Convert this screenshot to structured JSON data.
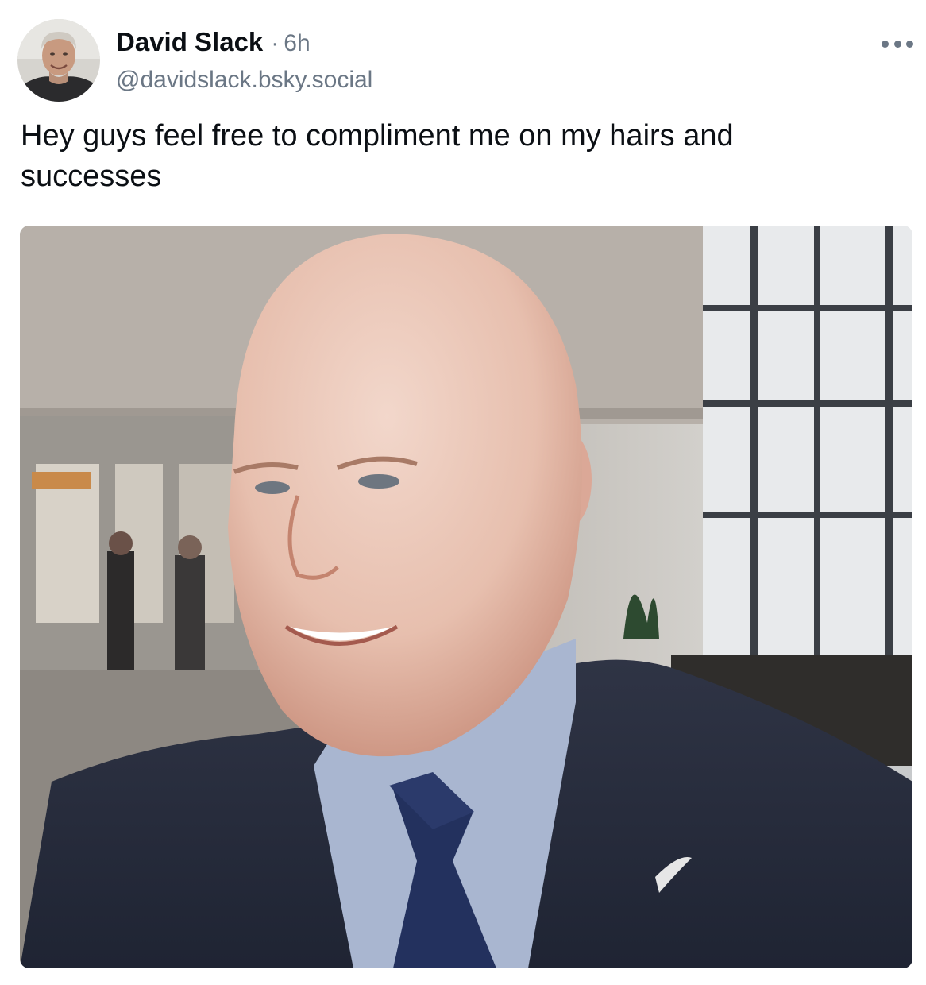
{
  "post": {
    "author": {
      "display_name": "David Slack",
      "handle": "@davidslack.bsky.social"
    },
    "separator": "·",
    "time": "6h",
    "text": "Hey guys feel free to compliment me on my hairs and successes",
    "media": {
      "kind": "photo"
    }
  },
  "icons": {
    "menu": "more-horizontal-icon"
  },
  "colors": {
    "text_primary": "#0b0f14",
    "text_secondary": "#6b7785",
    "background": "#ffffff"
  }
}
